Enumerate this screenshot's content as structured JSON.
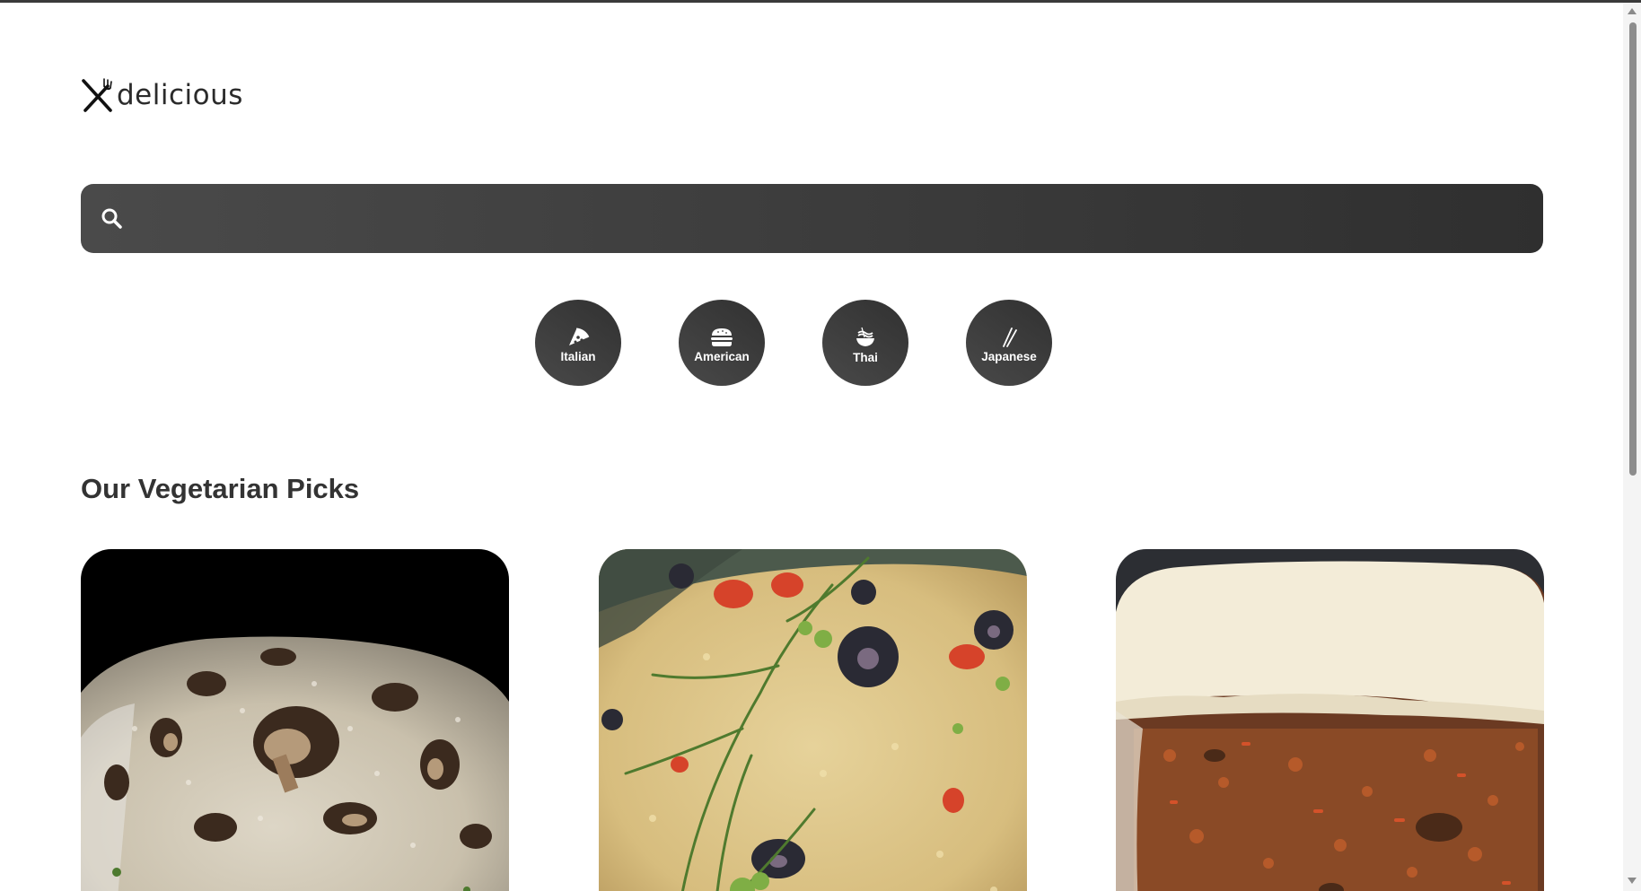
{
  "brand": {
    "name": "delicious",
    "icon": "fork-knife-icon"
  },
  "search": {
    "icon": "search-icon",
    "value": "",
    "placeholder": ""
  },
  "categories": [
    {
      "label": "Italian",
      "icon": "pizza-icon"
    },
    {
      "label": "American",
      "icon": "burger-icon"
    },
    {
      "label": "Thai",
      "icon": "noodle-bowl-icon"
    },
    {
      "label": "Japanese",
      "icon": "chopsticks-icon"
    }
  ],
  "section": {
    "title": "Our Vegetarian Picks"
  },
  "recipes": [
    {
      "image": "mushroom-risotto-photo"
    },
    {
      "image": "couscous-salad-photo"
    },
    {
      "image": "carrot-cake-photo"
    }
  ],
  "colors": {
    "accent": "#3b3b3b",
    "text": "#333333",
    "background": "#ffffff"
  }
}
